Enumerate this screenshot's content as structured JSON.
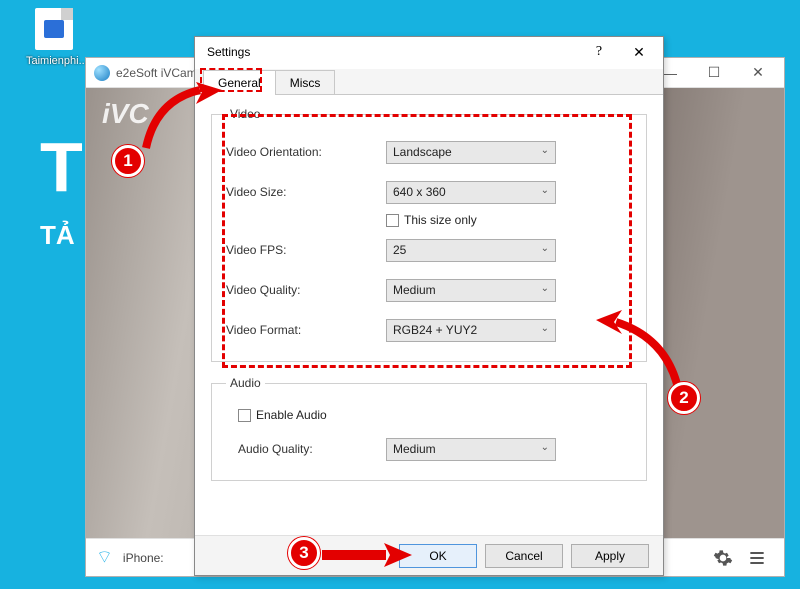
{
  "desktop": {
    "icon_label": "Taimienphi...."
  },
  "bgwin": {
    "title": "e2eSoft iVCam",
    "watermark": "iVC",
    "status_prefix": "iPhone: ",
    "big_t": "T",
    "big_ta": "TẢ"
  },
  "dialog": {
    "title": "Settings",
    "tabs": {
      "general": "General",
      "miscs": "Miscs"
    },
    "groups": {
      "video": "Video",
      "audio": "Audio"
    },
    "labels": {
      "orientation": "Video Orientation:",
      "size": "Video Size:",
      "size_only": "This size only",
      "fps": "Video FPS:",
      "quality": "Video Quality:",
      "format": "Video Format:",
      "enable_audio": "Enable Audio",
      "audio_quality": "Audio Quality:"
    },
    "values": {
      "orientation": "Landscape",
      "size": "640 x 360",
      "fps": "25",
      "quality": "Medium",
      "format": "RGB24 + YUY2",
      "audio_quality": "Medium"
    },
    "buttons": {
      "ok": "OK",
      "cancel": "Cancel",
      "apply": "Apply"
    }
  },
  "annotations": {
    "b1": "1",
    "b2": "2",
    "b3": "3"
  }
}
